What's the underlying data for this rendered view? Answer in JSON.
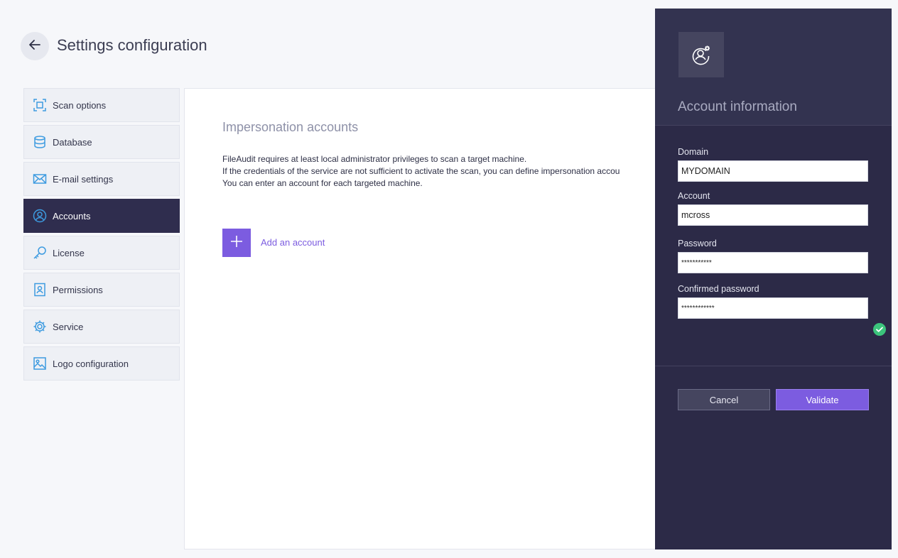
{
  "header": {
    "title": "Settings configuration",
    "back_icon": "arrow-left-icon"
  },
  "sidebar": {
    "items": [
      {
        "label": "Scan options",
        "icon": "scan-icon",
        "active": false
      },
      {
        "label": "Database",
        "icon": "database-icon",
        "active": false
      },
      {
        "label": "E-mail settings",
        "icon": "envelope-icon",
        "active": false
      },
      {
        "label": "Accounts",
        "icon": "user-circle-icon",
        "active": true
      },
      {
        "label": "License",
        "icon": "key-icon",
        "active": false
      },
      {
        "label": "Permissions",
        "icon": "badge-icon",
        "active": false
      },
      {
        "label": "Service",
        "icon": "gear-icon",
        "active": false
      },
      {
        "label": "Logo configuration",
        "icon": "image-icon",
        "active": false
      }
    ]
  },
  "main": {
    "section_title": "Impersonation accounts",
    "description": [
      "FileAudit requires at least local administrator privileges to scan a target machine.",
      "If the credentials of the service are not sufficient to activate the scan, you can define impersonation accou",
      "You can enter an account for each targeted machine."
    ],
    "add_account_label": "Add an account"
  },
  "drawer": {
    "title": "Account information",
    "icon": "user-gear-icon",
    "fields": {
      "domain": {
        "label": "Domain",
        "value": "MYDOMAIN"
      },
      "account": {
        "label": "Account",
        "value": "mcross"
      },
      "password": {
        "label": "Password",
        "value": "***********"
      },
      "confirmed_password": {
        "label": "Confirmed password",
        "value": "************"
      }
    },
    "cancel_label": "Cancel",
    "validate_label": "Validate"
  },
  "colors": {
    "accent": "#7c5ce0",
    "drawer_bg": "#2c2a47",
    "active_nav": "#2f2d4e",
    "success": "#3cc47c",
    "icon_blue": "#3d9be0"
  }
}
